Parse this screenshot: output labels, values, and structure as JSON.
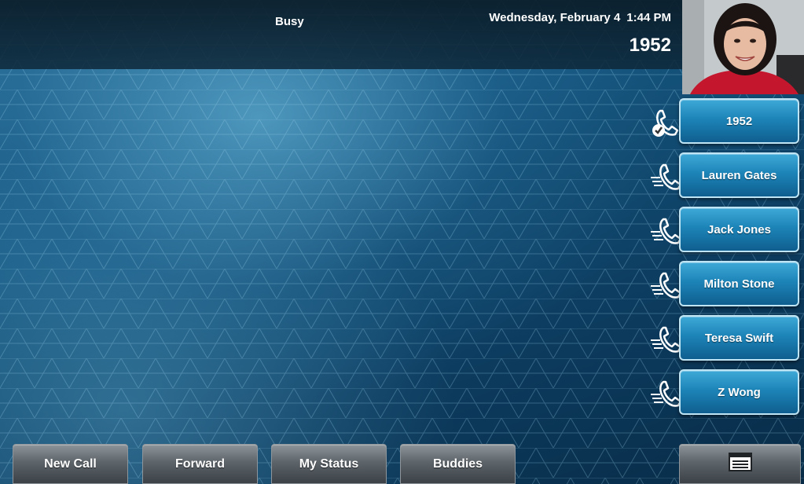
{
  "status_bar": {
    "status": "Busy",
    "date": "Wednesday, February 4",
    "time": "1:44 PM",
    "extension": "1952"
  },
  "video": {
    "icon": "contact-video-feed"
  },
  "line_keys": [
    {
      "label": "1952",
      "icon": "phone-registered-icon"
    },
    {
      "label": "Lauren Gates",
      "icon": "phone-speed-dial-icon"
    },
    {
      "label": "Jack Jones",
      "icon": "phone-speed-dial-icon"
    },
    {
      "label": "Milton Stone",
      "icon": "phone-speed-dial-icon"
    },
    {
      "label": "Teresa Swift",
      "icon": "phone-speed-dial-icon"
    },
    {
      "label": "Z Wong",
      "icon": "phone-speed-dial-icon"
    }
  ],
  "soft_keys": [
    {
      "label": "New Call"
    },
    {
      "label": "Forward"
    },
    {
      "label": "My Status"
    },
    {
      "label": "Buddies"
    }
  ],
  "menu_key": {
    "icon": "menu-list-icon"
  },
  "colors": {
    "accent_button": "#1d84b8",
    "softkey": "#5d646a",
    "background": "#15557e"
  }
}
